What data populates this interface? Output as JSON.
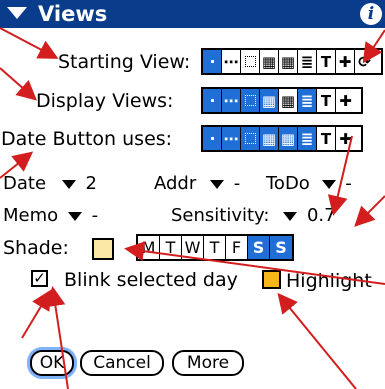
{
  "title": "Views",
  "info_icon": "i",
  "rows": {
    "starting_view_label": "Starting View:",
    "display_views_label": "Display Views:",
    "date_button_label": "Date Button uses:"
  },
  "popups": {
    "date_label": "Date",
    "date_value": "2",
    "addr_label": "Addr",
    "addr_value": "-",
    "todo_label": "ToDo",
    "todo_value": "-",
    "memo_label": "Memo",
    "memo_value": "-",
    "sensitivity_label": "Sensitivity:",
    "sensitivity_value": "0.7"
  },
  "shade": {
    "label": "Shade:",
    "color": "#fbe7a6",
    "days": [
      "M",
      "T",
      "W",
      "T",
      "F",
      "S",
      "S"
    ],
    "selected_days": [
      5,
      6
    ]
  },
  "blink": {
    "checked": true,
    "label": "Blink selected day",
    "highlight_label": "Highlight",
    "highlight_color": "#f6b51c"
  },
  "buttons": {
    "ok": "OK",
    "cancel": "Cancel",
    "more": "More"
  },
  "colors": {
    "title_bg": "#0a3c8c",
    "accent": "#1f6fd6",
    "arrow": "#d21e1e"
  },
  "view_icons": [
    "day",
    "week",
    "week-grid",
    "month",
    "year",
    "list",
    "todo",
    "tasks",
    "goto"
  ]
}
